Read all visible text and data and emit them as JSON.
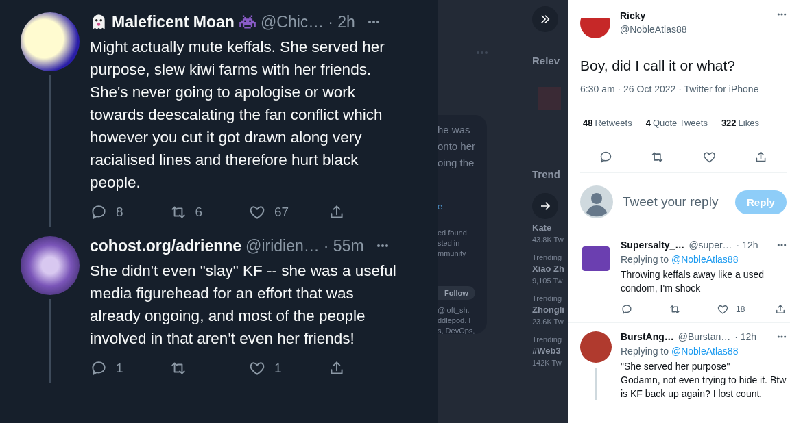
{
  "thread": [
    {
      "name": "Maleficent Moan",
      "name_emoji": true,
      "handle": "@Chic…",
      "time": "· 2h",
      "text": "Might actually mute keffals. She served her purpose, slew kiwi farms with her friends. She's never going to apologise or work towards deescalating the fan conflict which however you cut it got drawn along very racialised lines and therefore hurt black people.",
      "reply_count": "8",
      "retweet_count": "6",
      "like_count": "67"
    },
    {
      "name": "cohost.org/adrienne",
      "name_emoji": false,
      "handle": "@iridien…",
      "time": "· 55m",
      "text": "She didn't even \"slay\" KF -- she was a useful media figurehead for an effort that was already ongoing, and most of the people involved in that aren't even her friends!",
      "reply_count": "1",
      "like_count": "1"
    }
  ],
  "background_page": {
    "card_lines": [
      "he was",
      "onto her",
      "oing the"
    ],
    "card_link": "e",
    "profile_lines": [
      "ed found",
      "sted in",
      "mmunity"
    ],
    "follow_button": "Follow",
    "bio_lines": [
      "@ioft_sh.",
      "ddlepod. I",
      "s, DevOps,"
    ],
    "relevant_heading": "Relev",
    "trends_heading": "Trend",
    "trends": [
      {
        "topic": "Kate",
        "count": "43.8K Tw"
      },
      {
        "category": "Trending",
        "topic": "Xiao Zh",
        "count": "9,105 Tw"
      },
      {
        "category": "Trending",
        "topic": "Zhongli",
        "count": "23.6K Tw"
      },
      {
        "category": "Trending",
        "topic": "#Web3",
        "count": "142K Tw"
      }
    ]
  },
  "main_tweet": {
    "name": "Ricky",
    "handle": "@NobleAtlas88",
    "text": "Boy, did I call it or what?",
    "meta": "6:30 am · 26 Oct 2022 · Twitter for iPhone",
    "stats": [
      {
        "count": "48",
        "label": "Retweets"
      },
      {
        "count": "4",
        "label": "Quote Tweets"
      },
      {
        "count": "322",
        "label": "Likes"
      }
    ]
  },
  "reply_box": {
    "placeholder": "Tweet your reply",
    "button": "Reply"
  },
  "replies": [
    {
      "name": "Supersalty_…",
      "handle": "@super…",
      "time": "· 12h",
      "replying_label": "Replying to",
      "replying_handle": "@NobleAtlas88",
      "text": "Throwing keffals away like a used condom, I'm shock",
      "like_count": "18",
      "thread": false,
      "show_actions": true
    },
    {
      "name": "BurstAng…",
      "handle": "@Burstan…",
      "time": "· 12h",
      "replying_label": "Replying to",
      "replying_handle": "@NobleAtlas88",
      "text": "\"She served her purpose\"\nGodamn, not even trying to hide it. Btw is KF back up again? I lost count.",
      "thread": true,
      "show_actions": false
    }
  ]
}
